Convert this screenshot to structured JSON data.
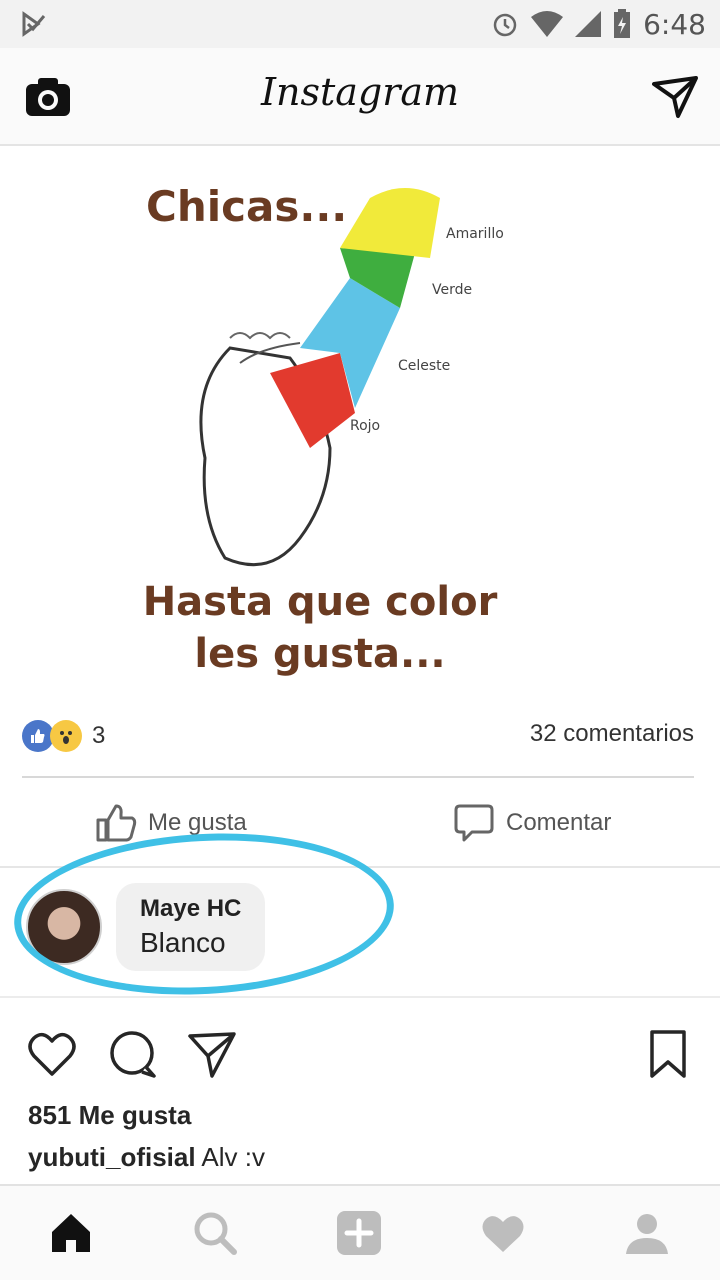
{
  "status_bar": {
    "time": "6:48"
  },
  "header": {
    "app_title": "Instagram"
  },
  "post": {
    "meme": {
      "top_text": "Chicas...",
      "bottom_text_line1": "Hasta que color",
      "bottom_text_line2": "les gusta...",
      "labels": [
        "Amarillo",
        "Verde",
        "Celeste",
        "Rojo"
      ],
      "band_colors": [
        "#f1ea3a",
        "#3fae3f",
        "#5ec3e6",
        "#e23a2e"
      ]
    },
    "reactions_count": "3",
    "comments_count": "32 comentarios",
    "like_label": "Me gusta",
    "comment_label": "Comentar",
    "comment": {
      "author": "Maye HC",
      "text": "Blanco"
    }
  },
  "ig": {
    "likes": "851 Me gusta",
    "caption_user": "yubuti_ofisial",
    "caption_text": "Alv :v"
  },
  "icons": [
    "camera-icon",
    "send-icon",
    "heart-icon",
    "comment-icon",
    "share-icon",
    "bookmark-icon",
    "home-icon",
    "search-icon",
    "add-icon",
    "activity-icon",
    "profile-icon"
  ],
  "colors": {
    "highlight": "#3fc0e6",
    "fb_blue": "#4a76c9",
    "meme_text": "#6a3b22"
  }
}
